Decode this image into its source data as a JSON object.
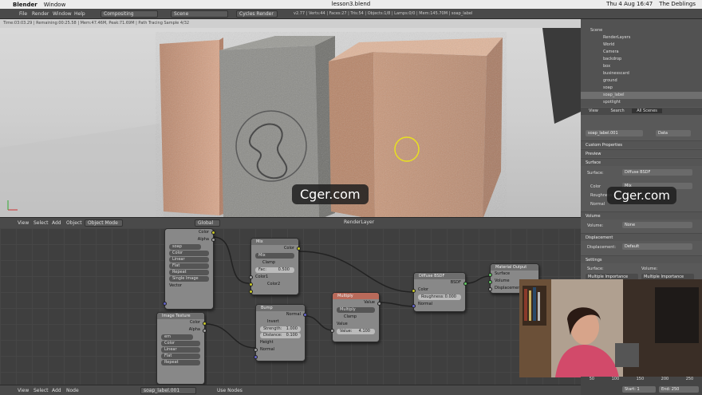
{
  "macbar": {
    "apple_glyph": "",
    "app_name": "Blender",
    "menu": [
      "Window"
    ],
    "window_title": "lesson3.blend",
    "clock": "Thu 4 Aug 16:47",
    "user": "The Deblings"
  },
  "header": {
    "menus": [
      "File",
      "Render",
      "Window",
      "Help"
    ],
    "layout_dropdown": "Compositing",
    "scene_dropdown": "Scene",
    "render_engine": "Cycles Render",
    "status_text": "v2.77 | Verts:44 | Faces:27 | Tris:54 | Objects:1/8 | Lamps:0/0 | Mem:145.70M | soap_label"
  },
  "render_info": "Time:03:03.29 | Remaining:00:25.58 | Mem:47.46M, Peak:71.69M | Path Tracing Sample 4/32",
  "watermarks": [
    "Cger.com",
    "Cger.com"
  ],
  "viewport_header": {
    "menus": [
      "View",
      "Select",
      "Add",
      "Object"
    ],
    "mode": "Object Mode",
    "orientation": "Global",
    "render_layer": "RenderLayer"
  },
  "nodes": {
    "image_texture_1": {
      "title": "Image Texture",
      "outputs": [
        "Color",
        "Alpha"
      ],
      "image_name": "soap",
      "options": [
        "Color",
        "Linear",
        "Flat",
        "Repeat",
        "Single Image"
      ],
      "inputs": [
        "Vector"
      ]
    },
    "mix": {
      "title": "Mix",
      "output": "Color",
      "blend_mode": "Mix",
      "clamp_label": "Clamp",
      "fac_label": "Fac:",
      "fac_value": "0.500",
      "inputs": [
        "Color1",
        "Color2"
      ]
    },
    "bump": {
      "title": "Bump",
      "output": "Normal",
      "invert_label": "Invert",
      "strength_label": "Strength:",
      "strength_value": "1.000",
      "distance_label": "Distance:",
      "distance_value": "0.100",
      "inputs": [
        "Height",
        "Normal"
      ]
    },
    "multiply": {
      "title": "Multiply",
      "output": "Value",
      "operation": "Multiply",
      "clamp_label": "Clamp",
      "value_label": "Value",
      "value_field_label": "Value:",
      "value_field": "4.100"
    },
    "diffuse": {
      "title": "Diffuse BSDF",
      "output": "BSDF",
      "color_label": "Color",
      "roughness_label": "Roughness:",
      "roughness_value": "0.000",
      "normal_label": "Normal"
    },
    "material_output": {
      "title": "Material Output",
      "inputs": [
        "Surface",
        "Volume",
        "Displacement"
      ]
    },
    "image_texture_2": {
      "title": "Image Texture",
      "outputs": [
        "Color",
        "Alpha"
      ],
      "image_name": "em",
      "options": [
        "Color",
        "Linear",
        "Flat",
        "Repeat"
      ]
    }
  },
  "node_editor_header": {
    "menus": [
      "View",
      "Select",
      "Add",
      "Node"
    ],
    "material_name": "soap_label.001",
    "use_nodes_label": "Use Nodes"
  },
  "outliner": {
    "items": [
      {
        "label": "Scene",
        "selected": false
      },
      {
        "label": "RenderLayers",
        "selected": false
      },
      {
        "label": "World",
        "selected": false
      },
      {
        "label": "Camera",
        "selected": false
      },
      {
        "label": "backdrop",
        "selected": false
      },
      {
        "label": "box",
        "selected": false
      },
      {
        "label": "businesscard",
        "selected": false
      },
      {
        "label": "ground",
        "selected": false
      },
      {
        "label": "soap",
        "selected": false
      },
      {
        "label": "soap_label",
        "selected": true
      },
      {
        "label": "spotlight",
        "selected": false
      }
    ],
    "footer_view": "View",
    "footer_search": "Search",
    "footer_filter": "All Scenes"
  },
  "properties": {
    "material_field": "soap_label.001",
    "data_dropdown": "Data",
    "sections": {
      "custom_props": "Custom Properties",
      "preview": "Preview",
      "surface": "Surface",
      "volume": "Volume",
      "displacement": "Displacement",
      "settings": "Settings"
    },
    "surface_label": "Surface:",
    "surface_value": "Diffuse BSDF",
    "color_label": "Color",
    "color_value": "Mix",
    "roughness_label": "Roughness",
    "normal_label": "Normal",
    "volume_label": "Volume:",
    "volume_value": "None",
    "displacement_label": "Displacement:",
    "displacement_value": "Default",
    "settings_surface": "Surface:",
    "settings_volume": "Volume:",
    "multiple_importance_1": "Multiple Importance",
    "multiple_importance_2": "Multiple Importance"
  },
  "timeline": {
    "ticks": [
      "50",
      "100",
      "150",
      "200",
      "250"
    ],
    "start_label": "Start:",
    "start_value": "1",
    "end_label": "End:",
    "end_value": "250"
  },
  "colors": {
    "socket_color": "#c7c729",
    "socket_shader": "#63c763",
    "socket_vector": "#6363c7",
    "multiply_header": "#b96a5a",
    "annotation_circle": "#e8e020"
  }
}
